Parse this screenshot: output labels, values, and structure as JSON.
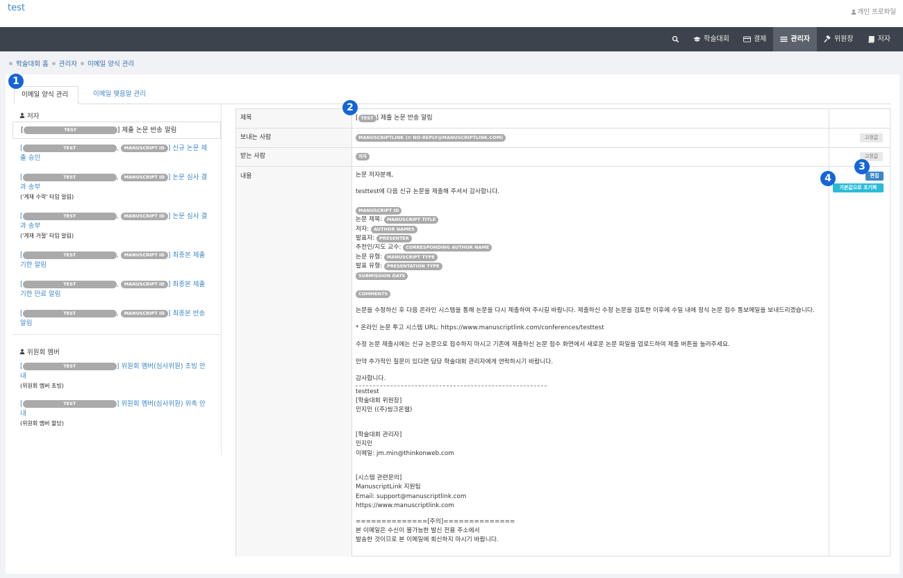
{
  "header": {
    "brand": "test",
    "profile": "개인 프로파일"
  },
  "nav": [
    {
      "label": "",
      "icon": "search-icon"
    },
    {
      "label": "학술대회",
      "icon": "graduation-cap-icon"
    },
    {
      "label": "결제",
      "icon": "credit-card-icon"
    },
    {
      "label": "관리자",
      "icon": "list-icon",
      "active": true
    },
    {
      "label": "위원장",
      "icon": "gavel-icon"
    },
    {
      "label": "저자",
      "icon": "book-icon"
    }
  ],
  "breadcrumb": [
    "학술대회 홈",
    "관리자",
    "이메일 양식 관리"
  ],
  "tabs": {
    "active": "이메일 양식 관리",
    "other": "이메일 맺음말 관리"
  },
  "badges": [
    "1",
    "2",
    "3",
    "4"
  ],
  "left": {
    "author_head": "저자",
    "committee_head": "위원회 멤버",
    "ph_test": "TEST",
    "ph_mid": "MANUSCRIPT ID",
    "items": [
      {
        "text": "] 제출 논문 반송 알림"
      },
      {
        "text": "] 신규 논문 제",
        "text2": "출 승인"
      },
      {
        "text": "] 논문 심사 결",
        "text2": "과 송부",
        "sub": "('게재 수락' 타입 알림)"
      },
      {
        "text": "] 논문 심사 결",
        "text2": "과 송부",
        "sub": "('게재 거절' 타입 알림)"
      },
      {
        "text": "] 최종본 제출",
        "text2": "기한 알림"
      },
      {
        "text": "] 최종본 제출",
        "text2": "기한 만료 알림"
      },
      {
        "text": "] 최종본 반송",
        "text2": "알림"
      },
      {
        "text": "] 위원회 멤버(심사위원) 초빙 안",
        "text2": "내",
        "sub": "(위원회 멤버 초빙)"
      },
      {
        "text": "] 위원회 멤버(심사위원) 위촉 안",
        "text2": "내",
        "sub": "(위원회 멤버 할당)"
      }
    ]
  },
  "table": {
    "subject_label": "제목",
    "subject_chip": "TEST",
    "subject_text": "] 제출 논문 반송 알림",
    "sender_label": "보내는 사람",
    "sender_chip": "MANUSCRIPTLINK (✉ NO-REPLY@MANUSCRIPTLINK.COM)",
    "receiver_label": "받는 사람",
    "receiver_chip": "저자",
    "fixed": "고정값",
    "content_label": "내용",
    "edit": "편집",
    "reset": "기본값으로 초기화",
    "body": {
      "greeting": "논문 저자분께,",
      "intro": "testtest에 다음 신규 논문을 제출해 주셔서 감사합니다.",
      "mid_chip": "MANUSCRIPT ID",
      "title_label": "논문 제목:",
      "title_chip": "MANUSCRIPT TITLE",
      "author_label": "저자:",
      "author_chip": "AUTHOR NAMES",
      "presenter_label": "발표자:",
      "presenter_chip": "PRESENTER",
      "corr_label": "추천인/지도 교수:",
      "corr_chip": "CORRESPONDING AUTHOR NAME",
      "type_label": "논문 유형:",
      "type_chip": "MANUSCRIPT TYPE",
      "ptype_label": "발표 유형:",
      "ptype_chip": "PRESENTATION TYPE",
      "date_chip": "SUBMISSION DATE",
      "comments_chip": "COMMENTS",
      "p1": "논문을 수정하신 후 다음 온라인 시스템을 통해 논문을 다시 제출하여 주시길 바랍니다. 제출하신 수정 논문을 검토한 이후에 수일 내에 정식 논문 접수 통보메일을 보내드리겠습니다.",
      "p2": "* 온라인 논문 투고 시스템 URL: https://www.manuscriptlink.com/conferences/testtest",
      "p3": "수정 논문 제출시에는 신규 논문으로 접수하지 마시고 기존에 제출하신 논문 접수 화면에서 새로운 논문 파일을 업로드하여 제출 버튼을 눌러주세요.",
      "p4": "만약 추가적인 질문이 있다면 담당 학술대회 관리자에게 연락하시기 바랍니다.",
      "thanks": "감사합니다.",
      "sig1": "testtest",
      "sig2": "[학술대회 위원장]",
      "sig3": "민지민 ((주)씽크온웹)",
      "sig4": "[학술대회 관리자]",
      "sig5": "민지민",
      "sig6": "이메일: jm.min@thinkonweb.com",
      "sig7": "[시스템 관련문의]",
      "sig8": "ManuscriptLink 지원팀",
      "sig9": "Email: support@manuscriptlink.com",
      "sig10": "https://www.manuscriptlink.com",
      "sig11": "==============[주의]==============",
      "sig12": "본 이메일은 수신이 불가능한 발신 전용 주소에서",
      "sig13": "발송한 것이므로 본 이메일에 회신하지 마시기 바랍니다."
    }
  }
}
